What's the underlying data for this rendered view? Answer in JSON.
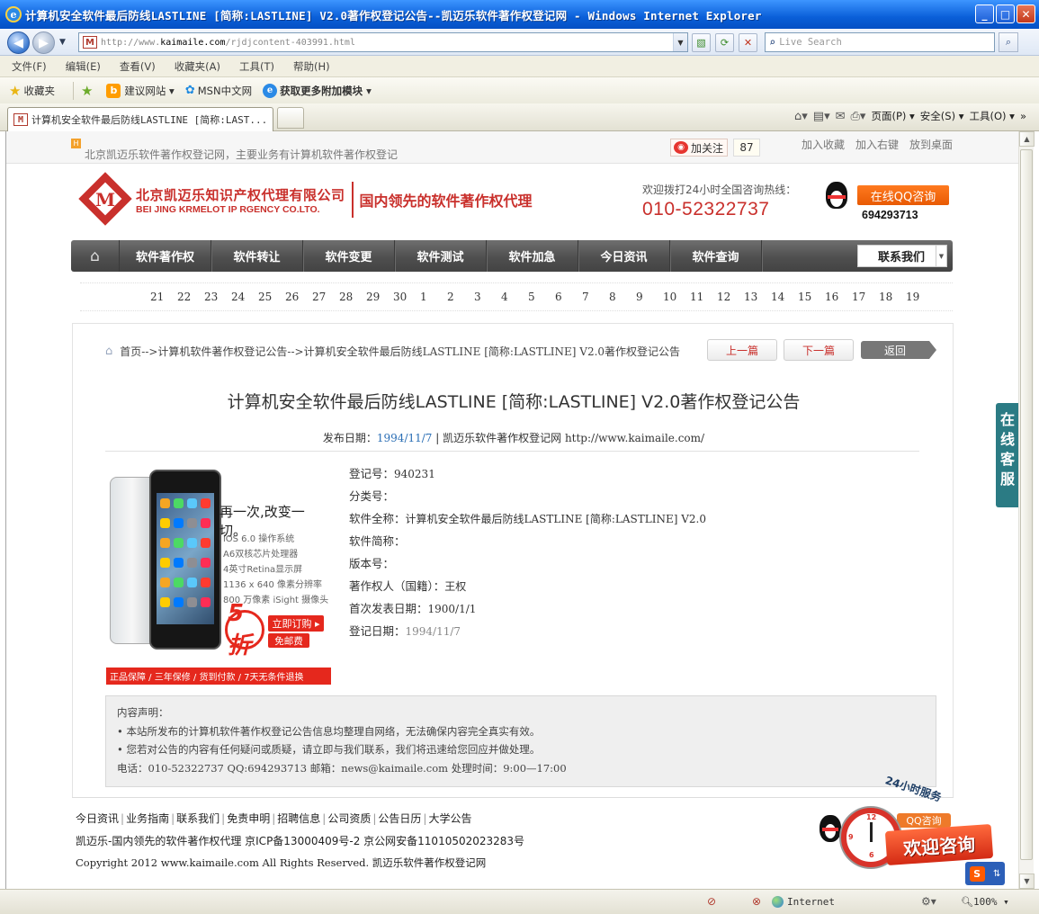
{
  "window": {
    "title": "计算机安全软件最后防线LASTLINE [简称:LASTLINE] V2.0著作权登记公告--凯迈乐软件著作权登记网 - Windows Internet Explorer",
    "minimize": "_",
    "maximize": "□",
    "close": "✕"
  },
  "address": {
    "url_prefix": "http://www.",
    "url_domain": "kaimaile.com",
    "url_path": "/rjdjcontent-403991.html",
    "search_placeholder": "Live Search"
  },
  "menu": [
    "文件(F)",
    "编辑(E)",
    "查看(V)",
    "收藏夹(A)",
    "工具(T)",
    "帮助(H)"
  ],
  "favorites": {
    "label": "收藏夹",
    "items": [
      "建议网站 ▾",
      "MSN中文网",
      "获取更多附加模块 ▾"
    ]
  },
  "tab": {
    "title": "计算机安全软件最后防线LASTLINE [简称:LAST..."
  },
  "commandbar": {
    "page": "页面(P) ▾",
    "safety": "安全(S) ▾",
    "tools": "工具(O) ▾"
  },
  "status": {
    "zone": "Internet",
    "zoom": "100%"
  },
  "site": {
    "tagline": "北京凯迈乐软件著作权登记网，主要业务有计算机软件著作权登记",
    "weibo_follow": "加关注",
    "weibo_count": "87",
    "top_links": [
      "加入收藏",
      "加入右键",
      "放到桌面"
    ],
    "logo_cn": "北京凯迈乐知识产权代理有限公司",
    "logo_en": "BEI JING KRMELOT IP RGENCY CO.LTO.",
    "slogan": "国内领先的软件著作权代理",
    "hotline_label": "欢迎拨打24小时全国咨询热线：",
    "hotline_number": "010-52322737",
    "qq_button": "在线QQ咨询",
    "qq_number": "694293713"
  },
  "nav": {
    "items": [
      "软件著作权",
      "软件转让",
      "软件变更",
      "软件测试",
      "软件加急",
      "今日资讯",
      "软件查询"
    ],
    "contact": "联系我们"
  },
  "dates": [
    "21",
    "22",
    "23",
    "24",
    "25",
    "26",
    "27",
    "28",
    "29",
    "30",
    "1",
    "2",
    "3",
    "4",
    "5",
    "6",
    "7",
    "8",
    "9",
    "10",
    "11",
    "12",
    "13",
    "14",
    "15",
    "16",
    "17",
    "18",
    "19"
  ],
  "breadcrumb": "首页-->计算机软件著作权登记公告-->计算机安全软件最后防线LASTLINE [简称:LASTLINE] V2.0著作权登记公告",
  "pager": {
    "prev": "上一篇",
    "next": "下一篇",
    "back": "返回"
  },
  "article": {
    "title": "计算机安全软件最后防线LASTLINE [简称:LASTLINE] V2.0著作权登记公告",
    "pub_label": "发布日期：",
    "pub_date": "1994/11/7",
    "pub_source": " | 凯迈乐软件著作权登记网 ",
    "pub_url": "http://www.kaimaile.com/",
    "fields": [
      {
        "label": "登记号：",
        "value": "940231",
        "gray": false
      },
      {
        "label": "分类号：",
        "value": "",
        "gray": false
      },
      {
        "label": "软件全称：",
        "value": "计算机安全软件最后防线LASTLINE [简称:LASTLINE] V2.0",
        "gray": false
      },
      {
        "label": "软件简称：",
        "value": "",
        "gray": false
      },
      {
        "label": "版本号：",
        "value": "",
        "gray": false
      },
      {
        "label": "著作权人（国籍）：",
        "value": "王权",
        "gray": false
      },
      {
        "label": "首次发表日期：",
        "value": "1900/1/1",
        "gray": false
      },
      {
        "label": "登记日期：",
        "value": "1994/11/7",
        "gray": true
      }
    ]
  },
  "ad": {
    "headline": "再一次,改变一切。",
    "specs": [
      "iOS 6.0 操作系统",
      "A6双核芯片处理器",
      "4英寸Retina显示屏",
      "1136 x 640 像素分辨率",
      "800 万像素 iSight 摄像头"
    ],
    "discount": "5折",
    "buy": "立即订购 ▸",
    "free_shipping": "免邮费",
    "guarantee": "正品保障 / 三年保修 / 货到付款 / 7天无条件退换"
  },
  "notice": {
    "title": "内容声明：",
    "line1": "• 本站所发布的计算机软件著作权登记公告信息均整理自网络，无法确保内容完全真实有效。",
    "line2": "• 您若对公告的内容有任何疑问或质疑，请立即与我们联系，我们将迅速给您回应并做处理。",
    "contact": "电话：010-52322737 QQ:694293713 邮箱：news@kaimaile.com 处理时间：9:00—17:00"
  },
  "footer": {
    "links": [
      "今日资讯",
      "业务指南",
      "联系我们",
      "免责申明",
      "招聘信息",
      "公司资质",
      "公告日历",
      "大学公告"
    ],
    "icp": "凯迈乐-国内领先的软件著作权代理  京ICP备13000409号-2  京公网安备11010502023283号",
    "copyright": "Copyright 2012 www.kaimaile.com All Rights Reserved. 凯迈乐软件著作权登记网"
  },
  "side_service": "在线客服",
  "float": {
    "badge": "24小时服务",
    "qq_label": "QQ咨询",
    "banner": "欢迎咨询"
  },
  "colors": {
    "brand_red": "#c9302c",
    "nav_gray": "#4f4f4f",
    "ie_blue": "#0a5fd8",
    "link_blue": "#2a6eb5"
  }
}
